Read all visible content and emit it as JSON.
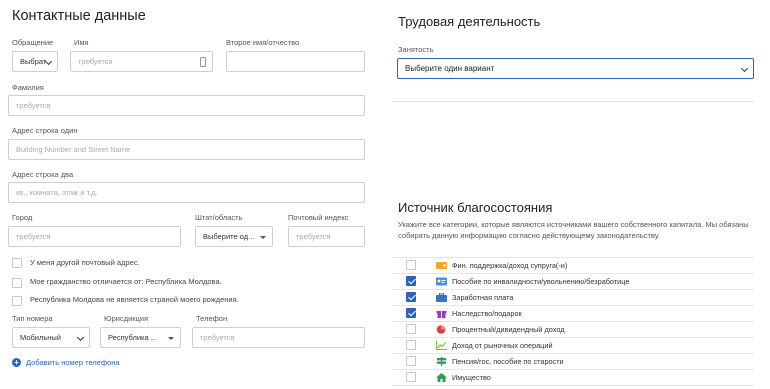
{
  "contact": {
    "title": "Контактные данные",
    "salutation_label": "Обращение",
    "salutation_value": "Выбрат",
    "first_name_label": "Имя",
    "first_name_placeholder": "требуется",
    "middle_name_label": "Второе имя/отчество",
    "last_name_label": "Фамилия",
    "last_name_placeholder": "требуется",
    "address1_label": "Адрес строка один",
    "address1_placeholder": "Building Number and Street Name",
    "address2_label": "Адрес строка два",
    "address2_placeholder": "кв., комната, этаж и т.д.",
    "city_label": "Город",
    "city_placeholder": "требуется",
    "state_label": "Штат/область",
    "state_value": "Выберите од...",
    "zip_label": "Почтовый индекс",
    "zip_placeholder": "требуется",
    "checkboxes": [
      "У меня другой почтовый адрес.",
      "Мое гражданство отличается от: Республика Молдова.",
      "Республика Молдова не является страной моего рождения."
    ],
    "phone_type_label": "Тип номера",
    "phone_type_value": "Мобильный",
    "jurisdiction_label": "Юрисдикция",
    "jurisdiction_value": "Республика ...",
    "phone_label": "Телефон",
    "phone_placeholder": "требуется",
    "add_phone_label": "Добавить номер телефона"
  },
  "employment": {
    "title": "Трудовая деятельность",
    "occupation_label": "Занятость",
    "occupation_value": "Выберите один вариант"
  },
  "wealth": {
    "title": "Источник благосостояния",
    "description": "Укажите все категории, которые являются источниками вашего собственного капитала. Мы обязаны собирать данную информацию согласно действующему законодательству.",
    "items": [
      {
        "label": "Фин. поддержка/доход супруга(-и)",
        "checked": false,
        "icon": "wallet-icon",
        "color": "#f5a623"
      },
      {
        "label": "Пособие по инвалидности/увольнению/безработице",
        "checked": true,
        "icon": "id-card-icon",
        "color": "#4a90d9"
      },
      {
        "label": "Заработная плата",
        "checked": true,
        "icon": "briefcase-icon",
        "color": "#3a6fc4"
      },
      {
        "label": "Наследство/подарок",
        "checked": true,
        "icon": "gift-icon",
        "color": "#8e3fb8"
      },
      {
        "label": "Процентный/дивидендный доход",
        "checked": false,
        "icon": "pie-chart-icon",
        "color": "#e23b3b"
      },
      {
        "label": "Доход от рыночных операций",
        "checked": false,
        "icon": "line-chart-icon",
        "color": "#7bbf3a"
      },
      {
        "label": "Пенсия/гос. пособие по старости",
        "checked": false,
        "icon": "signpost-icon",
        "color": "#2a9d55"
      },
      {
        "label": "Имущество",
        "checked": false,
        "icon": "house-icon",
        "color": "#2a9d55"
      }
    ]
  },
  "colors": {
    "accent": "#2a65b8",
    "border": "#cfcfcf"
  }
}
